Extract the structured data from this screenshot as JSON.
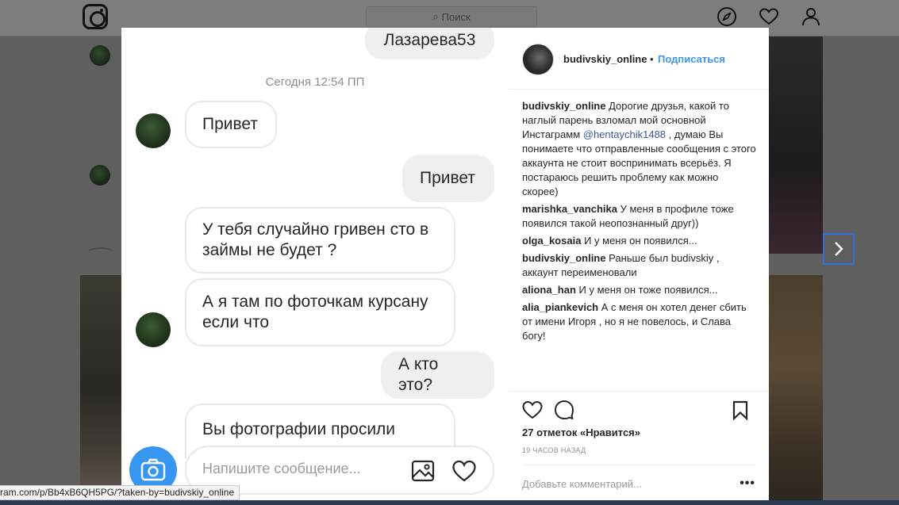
{
  "topbar": {
    "search_placeholder": "Поиск"
  },
  "icons": {
    "logo": "instagram-logo-icon",
    "explore": "compass-icon",
    "activity": "heart-icon",
    "profile": "person-icon",
    "next": "chevron-right-icon"
  },
  "chat": {
    "top_contact": "Лазарева53",
    "timestamp": "Сегодня 12:54 ПП",
    "messages": [
      {
        "from": "them",
        "text": "Привет"
      },
      {
        "from": "me",
        "text": "Привет"
      },
      {
        "from": "them",
        "text": "У тебя случайно гривен сто в займы не будет ?"
      },
      {
        "from": "them",
        "text": "А я там по фоточкам курсану если что"
      },
      {
        "from": "me",
        "text": "А кто это?"
      },
      {
        "from": "them",
        "text": "Вы фотографии просили"
      }
    ],
    "compose_placeholder": "Напишите сообщение..."
  },
  "post": {
    "username": "budivskiy_online",
    "separator": "•",
    "follow_label": "Подписаться",
    "caption": {
      "user": "budivskiy_online",
      "text_before": "Дорогие друзья, какой то наглый парень взломал мой основной Инстаграмм",
      "mention": "@hentaychik1488",
      "text_after": ", думаю Вы понимаете что отправленные сообщения с этого аккаунта не стоит воспринимать всерьёз. Я постараюсь решить проблему как можно скорее)"
    },
    "comments": [
      {
        "user": "marishka_vanchika",
        "text": "У меня в профиле тоже появился такой неопознанный друг))"
      },
      {
        "user": "olga_kosaia",
        "text": "И у меня он появился..."
      },
      {
        "user": "budivskiy_online",
        "text": "Раньше был budivskiy , аккаунт переименовали"
      },
      {
        "user": "aliona_han",
        "text": "И у меня он тоже появился..."
      },
      {
        "user": "alia_piankevich",
        "text": "А с меня он хотел денег сбить от имени Игоря , но я не повелось, и Слава богу!"
      }
    ],
    "likes": "27 отметок «Нравится»",
    "time_ago": "19 ЧАСОВ НАЗАД",
    "add_comment_placeholder": "Добавьте комментарий...",
    "more_label": "•••"
  },
  "statusbar": {
    "url": "ram.com/p/Bb4xB6QH5PG/?taken-by=budivskiy_online"
  }
}
